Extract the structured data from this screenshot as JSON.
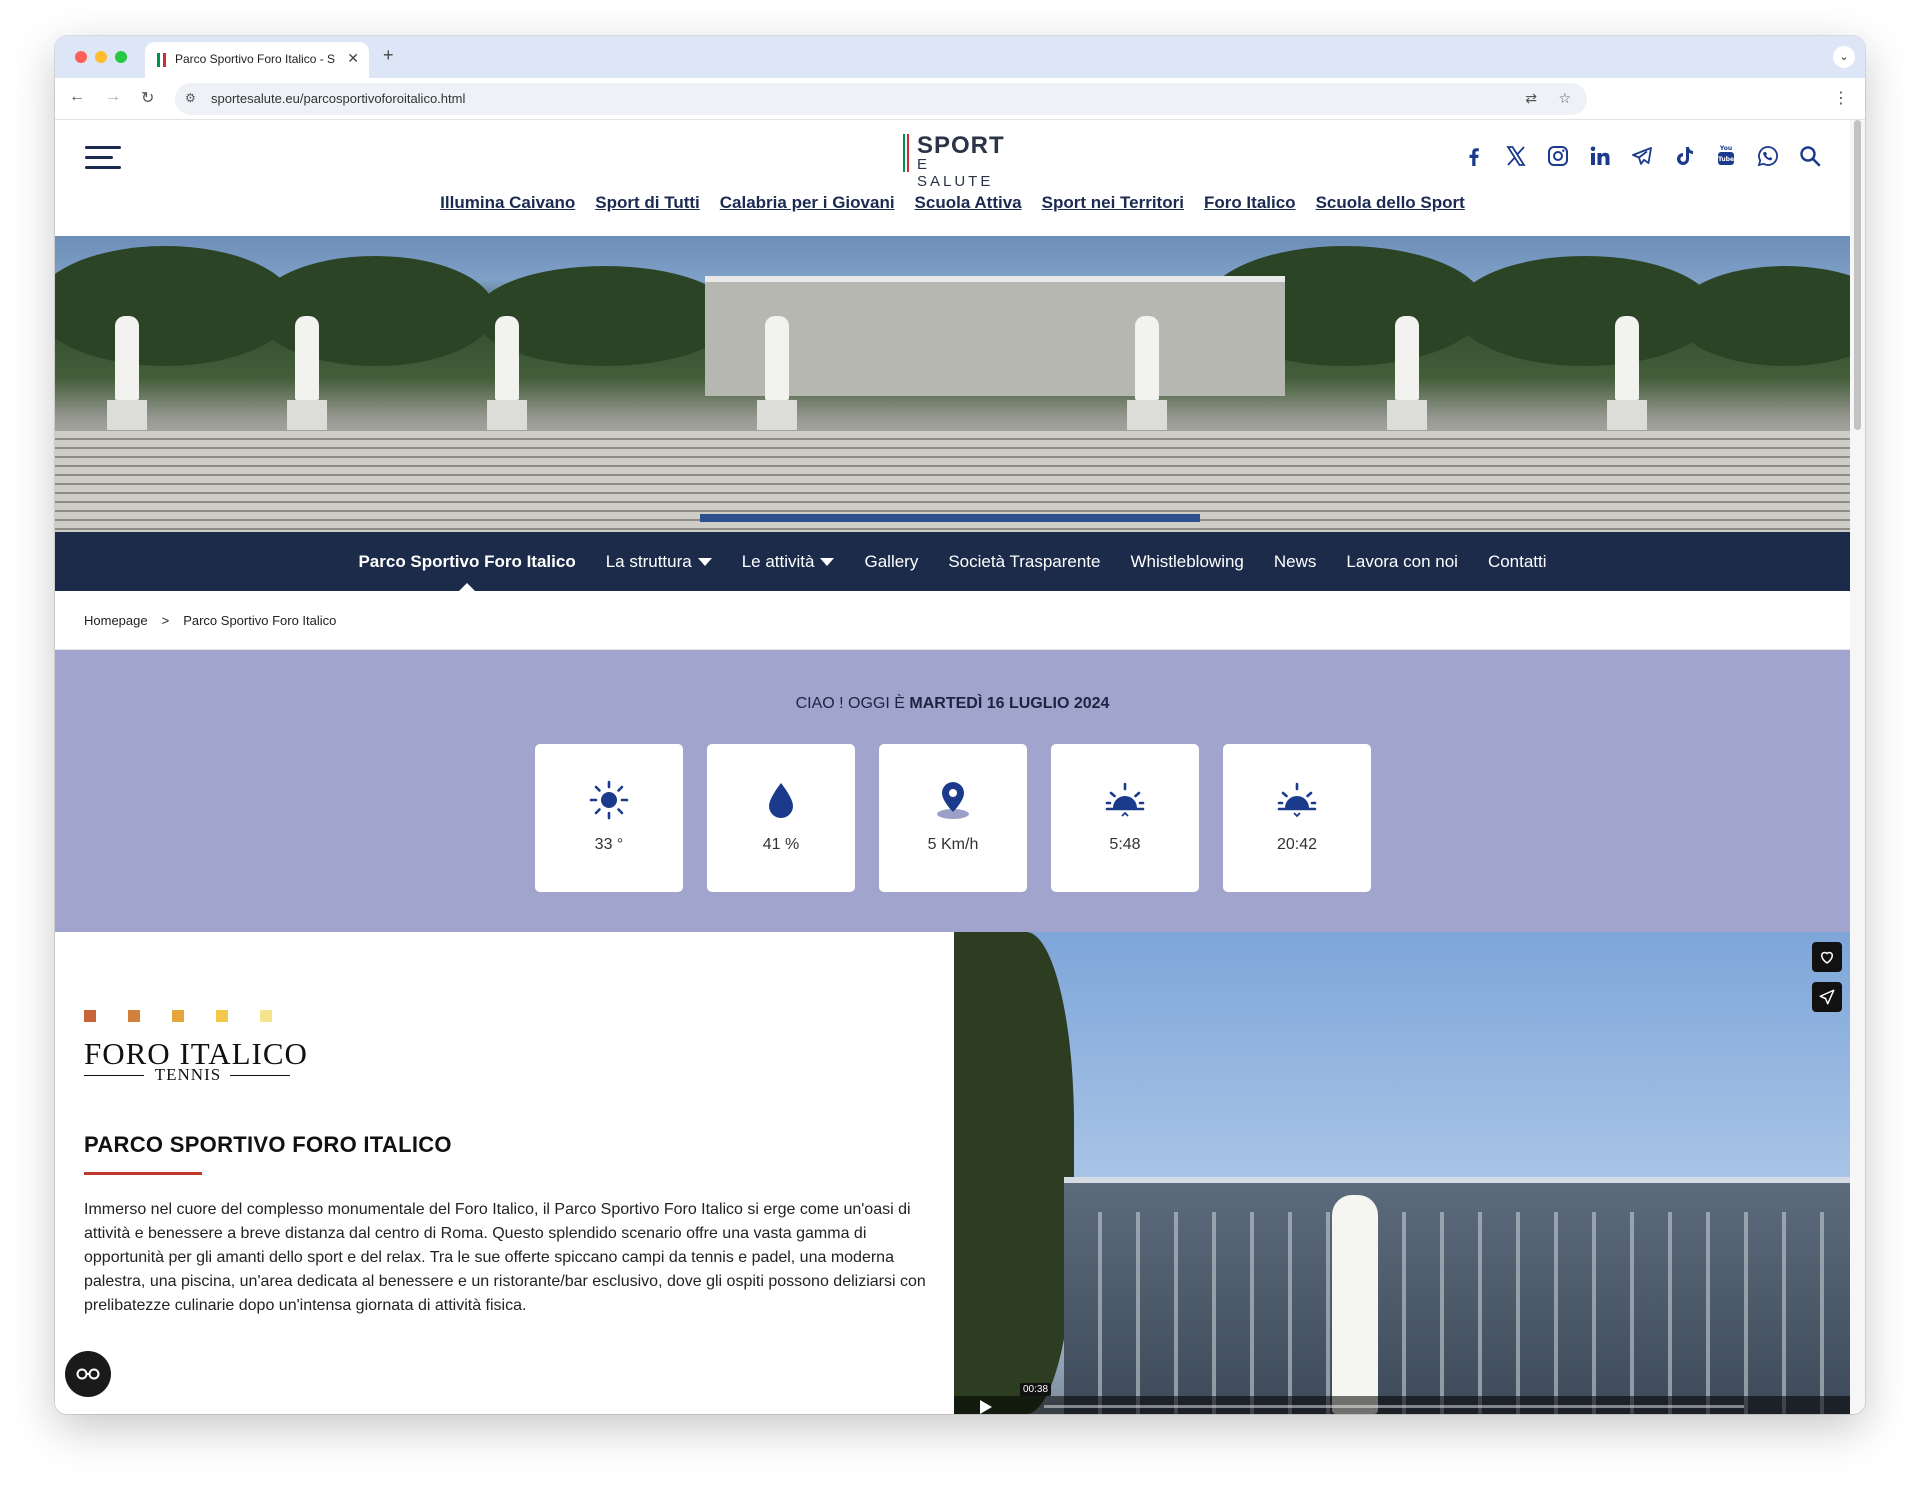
{
  "browser": {
    "tab_title": "Parco Sportivo Foro Italico - S",
    "new_tab_symbol": "+",
    "close_symbol": "✕",
    "url": "sportesalute.eu/parcosportivoforoitalico.html"
  },
  "header": {
    "logo_line1": "SPORT",
    "logo_line2": "E SALUTE",
    "social_icons": [
      "facebook-icon",
      "x-icon",
      "instagram-icon",
      "linkedin-icon",
      "telegram-icon",
      "tiktok-icon",
      "youtube-icon",
      "whatsapp-icon",
      "search-icon"
    ],
    "top_links": [
      "Illumina Caivano",
      "Sport di Tutti",
      "Calabria per i Giovani",
      "Scuola Attiva",
      "Sport nei Territori",
      "Foro Italico",
      "Scuola dello Sport"
    ]
  },
  "subnav": {
    "items": [
      "Parco Sportivo Foro Italico",
      "La struttura",
      "Le attività",
      "Gallery",
      "Società Trasparente",
      "Whistleblowing",
      "News",
      "Lavora con noi",
      "Contatti"
    ],
    "active_index": 0
  },
  "breadcrumb": {
    "home": "Homepage",
    "separator": ">",
    "current": "Parco Sportivo Foro Italico"
  },
  "weather": {
    "greeting_prefix": "CIAO ! OGGI È ",
    "date": "MARTEDÌ 16 LUGLIO 2024",
    "cards": [
      {
        "icon": "sun-icon",
        "value": "33 °"
      },
      {
        "icon": "water-drop-icon",
        "value": "41 %"
      },
      {
        "icon": "location-pin-icon",
        "value": "5 Km/h"
      },
      {
        "icon": "sunrise-icon",
        "value": "5:48"
      },
      {
        "icon": "sunset-icon",
        "value": "20:42"
      }
    ]
  },
  "content": {
    "brand_title": "FORO ITALICO",
    "brand_subtitle": "TENNIS",
    "title": "PARCO SPORTIVO FORO ITALICO",
    "body": "Immerso nel cuore del complesso monumentale del Foro Italico, il Parco Sportivo Foro Italico si erge come un'oasi di attività e benessere a breve distanza dal centro di Roma. Questo splendido scenario offre una vasta gamma di opportunità per gli amanti dello sport e del relax. Tra le sue offerte spiccano campi da tennis e padel, una moderna palestra, una piscina, un'area dedicata al benessere e un ristorante/bar esclusivo, dove gli ospiti possono deliziarsi con prelibatezze culinarie dopo un'intensa giornata di attività fisica."
  },
  "video": {
    "time": "00:38"
  },
  "colors": {
    "navy": "#1c2b4a",
    "weather_bg": "#a1a4cd",
    "icon_blue": "#1b3a8c",
    "accent_red": "#c0392b",
    "flag_green": "#009246",
    "flag_red": "#ce2b37",
    "fi_dots": [
      "#c8633c",
      "#d4803a",
      "#e7a63b",
      "#f2c94c",
      "#f5e58a"
    ]
  }
}
